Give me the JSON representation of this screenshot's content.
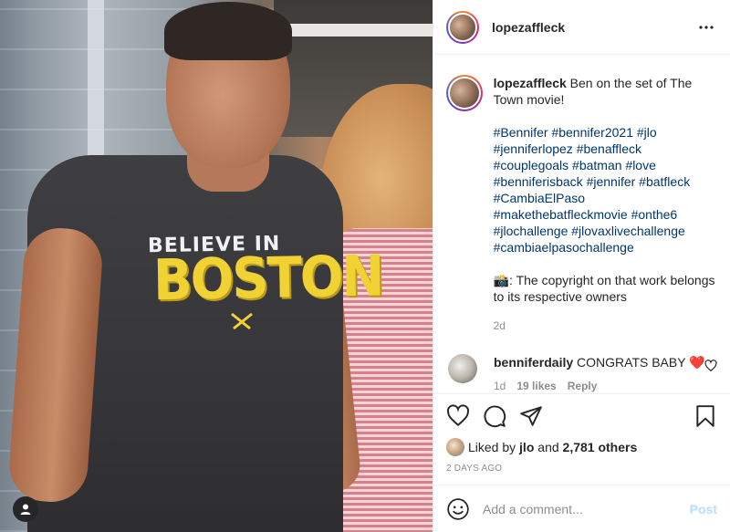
{
  "post": {
    "username": "lopezaffleck",
    "more_icon": "more-horizontal-icon",
    "photo": {
      "shirt_line_1": "BELIEVE IN",
      "shirt_line_2": "BOSTON",
      "user_tag_icon": "user-tag-icon"
    }
  },
  "caption": {
    "username": "lopezaffleck",
    "text": "Ben on the set of The Town movie!",
    "hashtags": [
      "#Bennifer",
      "#bennifer2021",
      "#jlo",
      "#jenniferlopez",
      "#benaffleck",
      "#couplegoals",
      "#batman",
      "#love",
      "#benniferisback",
      "#jennifer",
      "#batfleck",
      "#CambiaElPaso",
      "#makethebatfleckmovie",
      "#onthe6",
      "#jlochallenge",
      "#jlovaxlivechallenge",
      "#cambiaelpasochallenge"
    ],
    "copyright": "📸: The copyright on that work belongs to its respective owners",
    "time": "2d"
  },
  "comment": {
    "username": "benniferdaily",
    "text": "CONGRATS BABY",
    "emoji": "❤️",
    "time": "1d",
    "likes": "19 likes",
    "reply": "Reply"
  },
  "actions": {
    "icons": [
      "heart-icon",
      "comment-icon",
      "share-icon",
      "bookmark-icon"
    ],
    "liked_by_prefix": "Liked by",
    "liked_by_user": "jlo",
    "liked_by_and": "and",
    "liked_by_others": "2,781 others",
    "date": "2 DAYS AGO"
  },
  "add_comment": {
    "placeholder": "Add a comment...",
    "post_label": "Post"
  },
  "colors": {
    "link": "#00376b",
    "muted": "#8e8e8e",
    "post_button_disabled": "#b2dffc",
    "text": "#262626"
  }
}
